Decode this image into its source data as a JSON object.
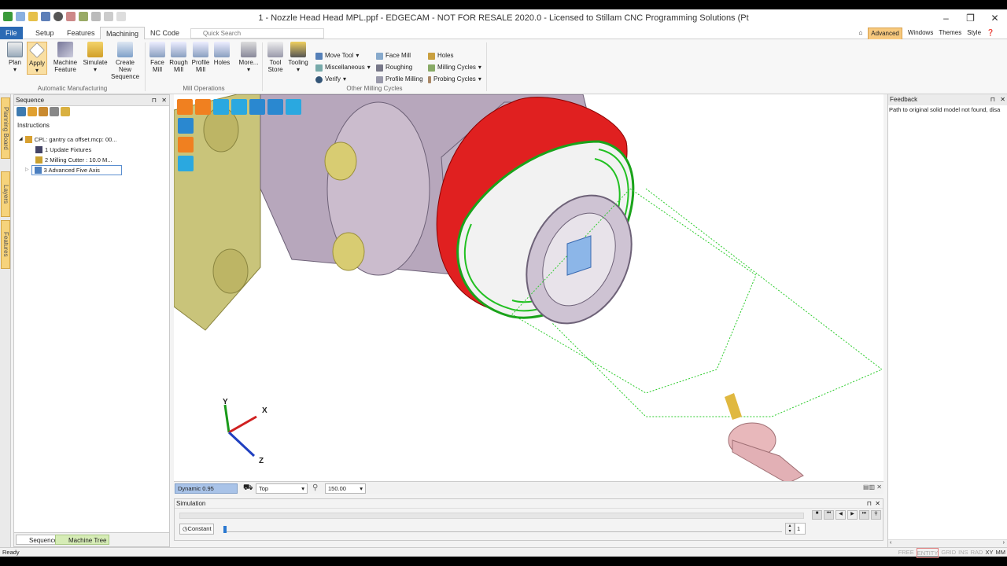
{
  "window": {
    "title": "1 - Nozzle Head Head MPL.ppf - EDGECAM - NOT FOR RESALE 2020.0 - Licensed to Stillam CNC Programming Solutions (Pt"
  },
  "tabs": [
    {
      "label": "File"
    },
    {
      "label": "Setup"
    },
    {
      "label": "Features"
    },
    {
      "label": "Machining"
    },
    {
      "label": "NC Code"
    }
  ],
  "quick_search": {
    "placeholder": "Quick Search"
  },
  "top_right": {
    "advanced": "Advanced",
    "windows": "Windows",
    "themes": "Themes",
    "style": "Style"
  },
  "ribbon": {
    "auto": {
      "plan": "Plan",
      "apply": "Apply",
      "machine1": "Machine",
      "machine2": "Feature",
      "simulate": "Simulate",
      "cns1": "Create New",
      "cns2": "Sequence",
      "group": "Automatic Manufacturing"
    },
    "mill": {
      "face1": "Face",
      "face2": "Mill",
      "rough1": "Rough",
      "rough2": "Mill",
      "prof1": "Profile",
      "prof2": "Mill",
      "holes": "Holes",
      "more": "More...",
      "group": "Mill Operations"
    },
    "other": {
      "ts1": "Tool",
      "ts2": "Store",
      "tooling": "Tooling",
      "move_tool": "Move Tool",
      "misc": "Miscellaneous",
      "verify": "Verify",
      "face_mill": "Face Mill",
      "roughing": "Roughing",
      "profile_milling": "Profile Milling",
      "holes": "Holes",
      "milling_cycles": "Milling Cycles",
      "probing_cycles": "Probing Cycles",
      "group": "Other Milling Cycles"
    }
  },
  "side_tabs": [
    "Planning Board",
    "Layers",
    "Features"
  ],
  "sequence": {
    "title": "Sequence",
    "instructions_label": "Instructions",
    "items": [
      {
        "label": "CPL: gantry ca offset.mcp: 00..."
      },
      {
        "label": "1 Update Fixtures"
      },
      {
        "label": "2 Milling Cutter : 10.0 M..."
      },
      {
        "label": "3 Advanced Five Axis"
      }
    ],
    "tab_sequence": "Sequence",
    "tab_machine_tree": "Machine Tree"
  },
  "viewport": {
    "axes": {
      "x": "X",
      "y": "Y",
      "z": "Z"
    },
    "dynamic": "Dynamic 0.95",
    "view": "Top",
    "zoom": "150.00"
  },
  "simulation": {
    "title": "Simulation",
    "mode": "Constant",
    "step": "1"
  },
  "feedback": {
    "title": "Feedback",
    "message": "Path to original solid model not found, disa"
  },
  "status": {
    "left": "Ready",
    "flags": [
      "FREE",
      "ENTITY",
      "GRID",
      "INS",
      "RAD",
      "XY",
      "MM"
    ]
  }
}
